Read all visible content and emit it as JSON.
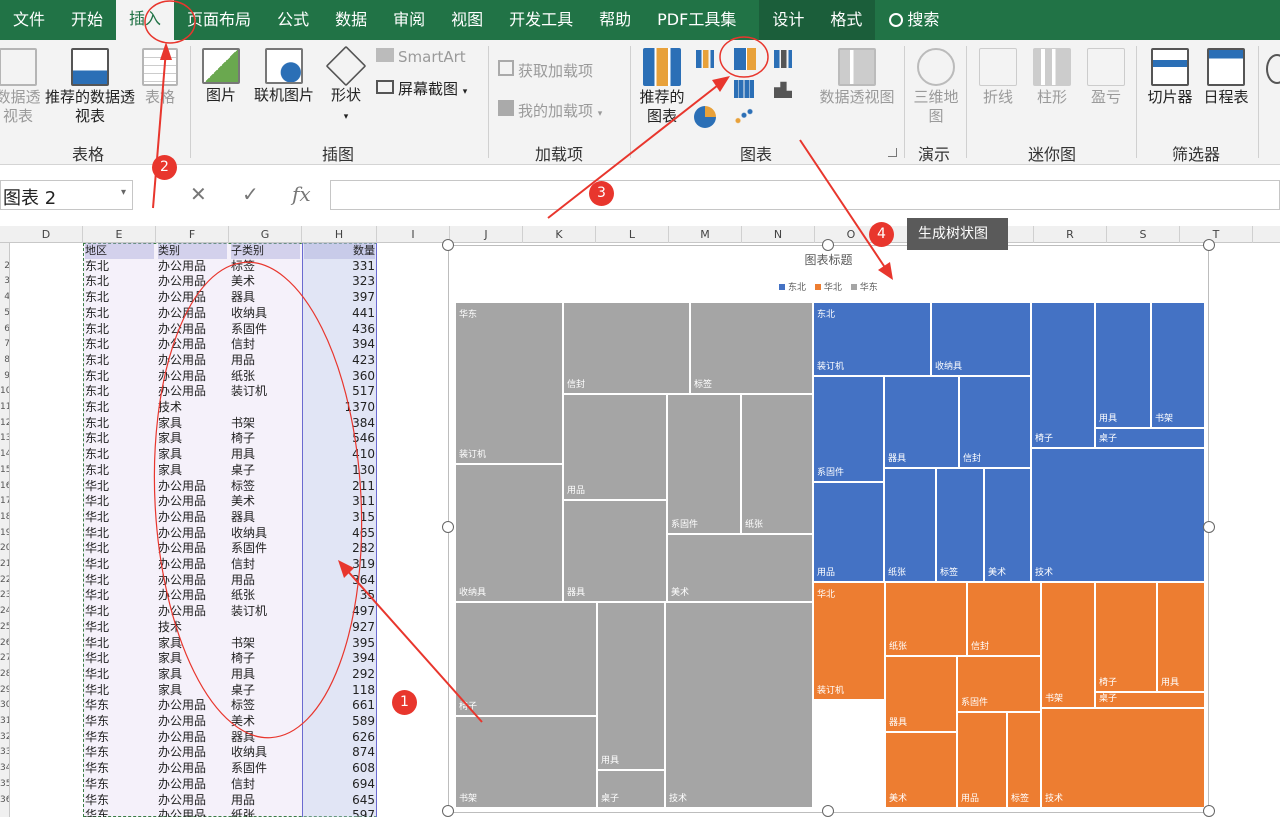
{
  "tabs": [
    {
      "label": "文件"
    },
    {
      "label": "开始"
    },
    {
      "label": "插入",
      "active": true
    },
    {
      "label": "页面布局"
    },
    {
      "label": "公式"
    },
    {
      "label": "数据"
    },
    {
      "label": "审阅"
    },
    {
      "label": "视图"
    },
    {
      "label": "开发工具"
    },
    {
      "label": "帮助"
    },
    {
      "label": "PDF工具集"
    },
    {
      "label": "设计",
      "contextual": true
    },
    {
      "label": "格式",
      "contextual": true
    },
    {
      "label": "搜索",
      "search": true
    }
  ],
  "ribbon": {
    "pivot_label": "数据透视表",
    "recommended_pivot_label": "推荐的数据透视表",
    "table_label": "表格",
    "group_tables": "表格",
    "picture_label": "图片",
    "online_picture_label": "联机图片",
    "shapes_label": "形状",
    "smartart_label": "SmartArt",
    "screenshot_label": "屏幕截图",
    "group_illustrations": "插图",
    "get_addins_label": "获取加载项",
    "my_addins_label": "我的加载项",
    "group_addins": "加载项",
    "recommended_charts_label": "推荐的图表",
    "pivotchart_label": "数据透视图",
    "group_charts": "图表",
    "map3d_label": "三维地图",
    "group_tours": "演示",
    "line_spark_label": "折线",
    "column_spark_label": "柱形",
    "winloss_spark_label": "盈亏",
    "group_sparklines": "迷你图",
    "slicer_label": "切片器",
    "timeline_label": "日程表",
    "group_filters": "筛选器"
  },
  "formula_bar": {
    "name_box": "图表 2",
    "fx": "fx",
    "cancel": "✕",
    "enter": "✓",
    "value": ""
  },
  "columns": [
    "D",
    "E",
    "F",
    "G",
    "H",
    "I",
    "J",
    "K",
    "L",
    "M",
    "N",
    "O",
    "P",
    "Q",
    "R",
    "S",
    "T"
  ],
  "row_numbers": [
    "",
    "2",
    "3",
    "4",
    "5",
    "6",
    "7",
    "8",
    "9",
    "10",
    "11",
    "12",
    "13",
    "14",
    "15",
    "16",
    "17",
    "18",
    "19",
    "20",
    "21",
    "22",
    "23",
    "24",
    "25",
    "26",
    "27",
    "28",
    "29",
    "30",
    "31",
    "32",
    "33",
    "34",
    "35",
    "36"
  ],
  "table": {
    "headers": [
      "地区",
      "类别",
      "子类别",
      "数量"
    ],
    "rows": [
      [
        "东北",
        "办公用品",
        "标签",
        "331"
      ],
      [
        "东北",
        "办公用品",
        "美术",
        "323"
      ],
      [
        "东北",
        "办公用品",
        "器具",
        "397"
      ],
      [
        "东北",
        "办公用品",
        "收纳具",
        "441"
      ],
      [
        "东北",
        "办公用品",
        "系固件",
        "436"
      ],
      [
        "东北",
        "办公用品",
        "信封",
        "394"
      ],
      [
        "东北",
        "办公用品",
        "用品",
        "423"
      ],
      [
        "东北",
        "办公用品",
        "纸张",
        "360"
      ],
      [
        "东北",
        "办公用品",
        "装订机",
        "517"
      ],
      [
        "东北",
        "技术",
        "",
        "1370"
      ],
      [
        "东北",
        "家具",
        "书架",
        "384"
      ],
      [
        "东北",
        "家具",
        "椅子",
        "546"
      ],
      [
        "东北",
        "家具",
        "用具",
        "410"
      ],
      [
        "东北",
        "家具",
        "桌子",
        "130"
      ],
      [
        "华北",
        "办公用品",
        "标签",
        "211"
      ],
      [
        "华北",
        "办公用品",
        "美术",
        "311"
      ],
      [
        "华北",
        "办公用品",
        "器具",
        "315"
      ],
      [
        "华北",
        "办公用品",
        "收纳具",
        "465"
      ],
      [
        "华北",
        "办公用品",
        "系固件",
        "282"
      ],
      [
        "华北",
        "办公用品",
        "信封",
        "319"
      ],
      [
        "华北",
        "办公用品",
        "用品",
        "364"
      ],
      [
        "华北",
        "办公用品",
        "纸张",
        "35"
      ],
      [
        "华北",
        "办公用品",
        "装订机",
        "497"
      ],
      [
        "华北",
        "技术",
        "",
        "927"
      ],
      [
        "华北",
        "家具",
        "书架",
        "395"
      ],
      [
        "华北",
        "家具",
        "椅子",
        "394"
      ],
      [
        "华北",
        "家具",
        "用具",
        "292"
      ],
      [
        "华北",
        "家具",
        "桌子",
        "118"
      ],
      [
        "华东",
        "办公用品",
        "标签",
        "661"
      ],
      [
        "华东",
        "办公用品",
        "美术",
        "589"
      ],
      [
        "华东",
        "办公用品",
        "器具",
        "626"
      ],
      [
        "华东",
        "办公用品",
        "收纳具",
        "874"
      ],
      [
        "华东",
        "办公用品",
        "系固件",
        "608"
      ],
      [
        "华东",
        "办公用品",
        "信封",
        "694"
      ],
      [
        "华东",
        "办公用品",
        "用品",
        "645"
      ],
      [
        "华东",
        "办公用品",
        "纸张",
        "597"
      ]
    ]
  },
  "chart": {
    "title": "图表标题",
    "legend": [
      {
        "name": "东北",
        "color": "#4472c4"
      },
      {
        "name": "华北",
        "color": "#ed7d31"
      },
      {
        "name": "华东",
        "color": "#a5a5a5"
      }
    ]
  },
  "chart_data": {
    "type": "treemap",
    "title": "图表标题",
    "series": [
      {
        "name": "华东",
        "color": "#a5a5a5",
        "items": [
          {
            "label": "装订机"
          },
          {
            "label": "信封"
          },
          {
            "label": "标签"
          },
          {
            "label": "用品"
          },
          {
            "label": "系固件"
          },
          {
            "label": "纸张"
          },
          {
            "label": "收纳具"
          },
          {
            "label": "器具"
          },
          {
            "label": "美术"
          },
          {
            "label": "椅子"
          },
          {
            "label": "书架"
          },
          {
            "label": "用具"
          },
          {
            "label": "桌子"
          },
          {
            "label": "技术"
          }
        ]
      },
      {
        "name": "东北",
        "color": "#4472c4",
        "items": [
          {
            "label": "装订机"
          },
          {
            "label": "收纳具"
          },
          {
            "label": "椅子"
          },
          {
            "label": "用具"
          },
          {
            "label": "书架"
          },
          {
            "label": "桌子"
          },
          {
            "label": "系固件"
          },
          {
            "label": "器具"
          },
          {
            "label": "信封"
          },
          {
            "label": "用品"
          },
          {
            "label": "纸张"
          },
          {
            "label": "标签"
          },
          {
            "label": "美术"
          },
          {
            "label": "技术"
          }
        ]
      },
      {
        "name": "华北",
        "color": "#ed7d31",
        "items": [
          {
            "label": "装订机"
          },
          {
            "label": "纸张"
          },
          {
            "label": "信封"
          },
          {
            "label": "器具"
          },
          {
            "label": "系固件"
          },
          {
            "label": "椅子"
          },
          {
            "label": "用具"
          },
          {
            "label": "书架"
          },
          {
            "label": "桌子"
          },
          {
            "label": "美术"
          },
          {
            "label": "用品"
          },
          {
            "label": "标签"
          },
          {
            "label": "技术"
          }
        ]
      }
    ]
  },
  "annotations": {
    "step1": "1",
    "step2": "2",
    "step3": "3",
    "step4": "4",
    "tooltip": "生成树状图"
  }
}
